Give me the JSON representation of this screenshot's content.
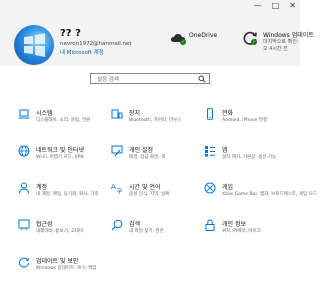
{
  "window": {
    "minimize": "—",
    "maximize": "□",
    "close": "✕"
  },
  "account": {
    "name": "?? ?",
    "email": "nevron1972@hanmail.net",
    "link": "내 Microsoft 계정"
  },
  "onedrive": {
    "label": "OneDrive",
    "sub": ""
  },
  "update": {
    "label": "Windows 업데이트",
    "sub1": "마지막으로 확인:",
    "sub2": "오 4시간 전"
  },
  "search": {
    "placeholder": "설정 검색"
  },
  "colors": {
    "accent": "#0078d4",
    "ok": "#107c10"
  },
  "categories": [
    {
      "icon": "laptop-icon",
      "title": "시스템",
      "desc": "디스플레이, 소리, 알림, 전원"
    },
    {
      "icon": "devices-icon",
      "title": "장치",
      "desc": "Bluetooth, 프린터, 마우스"
    },
    {
      "icon": "phone-icon",
      "title": "전화",
      "desc": "Android, iPhone 연결"
    },
    {
      "icon": "globe-icon",
      "title": "네트워크 및 인터넷",
      "desc": "Wi-Fi, 비행기 모드, VPN"
    },
    {
      "icon": "brush-icon",
      "title": "개인 설정",
      "desc": "배경, 잠금 화면, 색"
    },
    {
      "icon": "apps-icon",
      "title": "앱",
      "desc": "설치 제거, 기본값, 옵션 기능"
    },
    {
      "icon": "person-icon",
      "title": "계정",
      "desc": "내 계정, 메일, 동기화, 회사, 가족"
    },
    {
      "icon": "time-language-icon",
      "title": "시간 및 언어",
      "desc": "음성 인식, 지역, 날짜"
    },
    {
      "icon": "xbox-icon",
      "title": "게임",
      "desc": "Xbox Game Bar, 캡처, 브로드캐스트, 게임 모드"
    },
    {
      "icon": "accessibility-icon",
      "title": "접근성",
      "desc": "내레이터, 돋보기, 고대비"
    },
    {
      "icon": "search-icon",
      "title": "검색",
      "desc": "내 파일 찾기, 권한"
    },
    {
      "icon": "lock-icon",
      "title": "개인 정보",
      "desc": "위치, 카메라, 마이크"
    },
    {
      "icon": "update-icon",
      "title": "업데이트 및 보안",
      "desc": "Windows 업데이트, 복구, 백업"
    }
  ]
}
